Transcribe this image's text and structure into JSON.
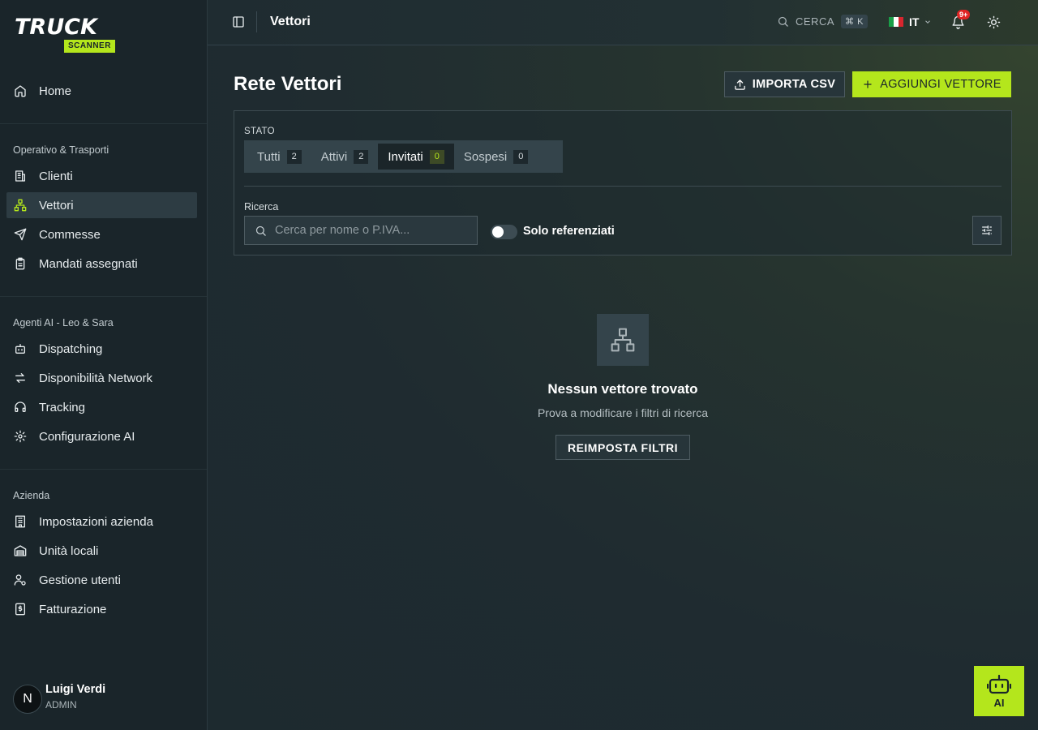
{
  "brand": {
    "line1": "TRUCK",
    "line2": "SCANNER"
  },
  "colors": {
    "accent": "#b4e61c",
    "bg": "#1d2a2f",
    "sidebar": "#1a252a",
    "badge": "#e02424"
  },
  "sidebar": {
    "home": {
      "label": "Home",
      "icon": "home-icon"
    },
    "sections": [
      {
        "title": "Operativo & Trasporti",
        "items": [
          {
            "label": "Clienti",
            "icon": "building-icon"
          },
          {
            "label": "Vettori",
            "icon": "network-icon",
            "active": true
          },
          {
            "label": "Commesse",
            "icon": "send-icon"
          },
          {
            "label": "Mandati assegnati",
            "icon": "clipboard-icon"
          }
        ]
      },
      {
        "title": "Agenti AI - Leo & Sara",
        "items": [
          {
            "label": "Dispatching",
            "icon": "bot-icon"
          },
          {
            "label": "Disponibilità Network",
            "icon": "arrows-icon"
          },
          {
            "label": "Tracking",
            "icon": "headset-icon"
          },
          {
            "label": "Configurazione AI",
            "icon": "gear-icon"
          }
        ]
      },
      {
        "title": "Azienda",
        "items": [
          {
            "label": "Impostazioni azienda",
            "icon": "office-icon"
          },
          {
            "label": "Unità locali",
            "icon": "warehouse-icon"
          },
          {
            "label": "Gestione utenti",
            "icon": "user-gear-icon"
          },
          {
            "label": "Fatturazione",
            "icon": "invoice-icon"
          }
        ]
      }
    ],
    "user": {
      "initial": "N",
      "name": "Luigi Verdi",
      "role": "ADMIN"
    }
  },
  "topbar": {
    "title": "Vettori",
    "search_label": "CERCA",
    "search_kbd": "⌘ K",
    "lang": "IT",
    "notifications": "9+"
  },
  "page": {
    "title": "Rete Vettori",
    "import_label": "IMPORTA CSV",
    "add_label": "AGGIUNGI VETTORE",
    "filters": {
      "status_label": "STATO",
      "tabs": [
        {
          "label": "Tutti",
          "count": "2"
        },
        {
          "label": "Attivi",
          "count": "2"
        },
        {
          "label": "Invitati",
          "count": "0",
          "active": true
        },
        {
          "label": "Sospesi",
          "count": "0"
        }
      ],
      "search_label": "Ricerca",
      "search_placeholder": "Cerca per nome o P.IVA...",
      "toggle_label": "Solo referenziati",
      "toggle_on": false
    },
    "empty": {
      "title": "Nessun vettore trovato",
      "subtitle": "Prova a modificare i filtri di ricerca",
      "reset_label": "REIMPOSTA FILTRI"
    },
    "ai_label": "AI"
  }
}
